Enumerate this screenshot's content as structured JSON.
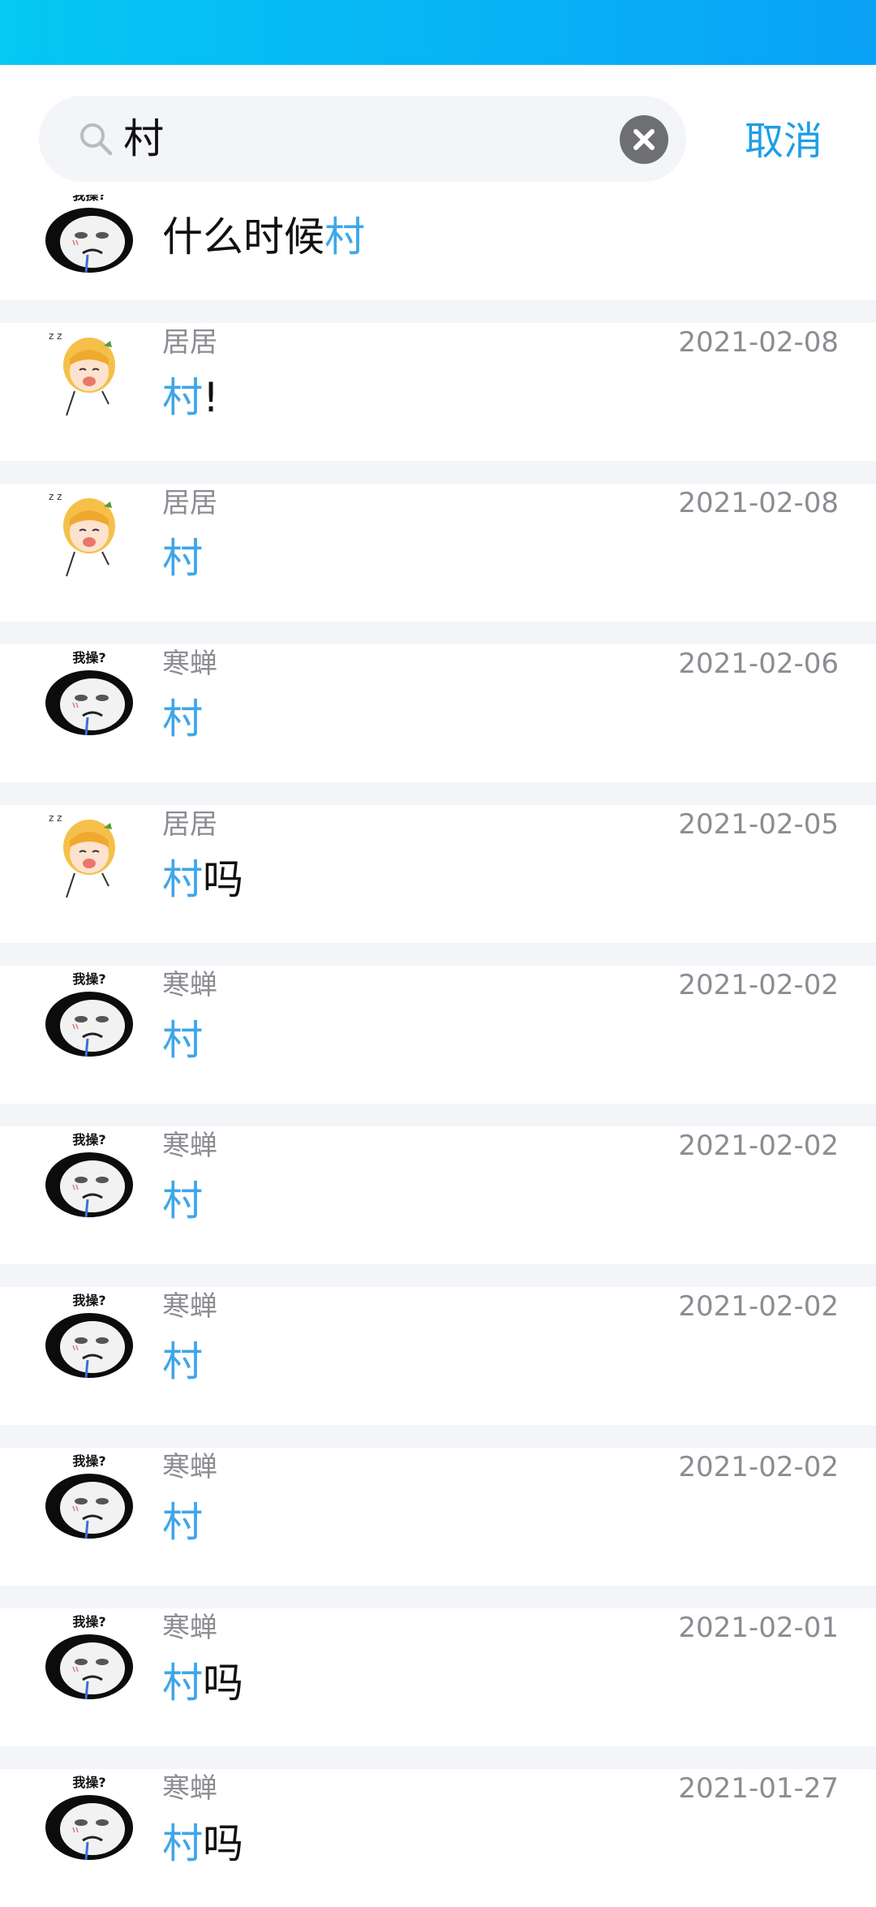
{
  "colors": {
    "accent": "#1f9ee5",
    "highlight": "#3fa6e8",
    "topbar_start": "#05c8f3",
    "topbar_end": "#0aa2f7"
  },
  "search": {
    "query": "村",
    "cancel_label": "取消"
  },
  "first_result": {
    "text_before": "什么时候",
    "highlight": "村",
    "avatar": "panda-meme"
  },
  "results": [
    {
      "sender": "居居",
      "date": "2021-02-08",
      "highlight": "村",
      "rest": "!",
      "avatar": "anime-girl"
    },
    {
      "sender": "居居",
      "date": "2021-02-08",
      "highlight": "村",
      "rest": "",
      "avatar": "anime-girl"
    },
    {
      "sender": "寒蝉",
      "date": "2021-02-06",
      "highlight": "村",
      "rest": "",
      "avatar": "panda-meme"
    },
    {
      "sender": "居居",
      "date": "2021-02-05",
      "highlight": "村",
      "rest": "吗",
      "avatar": "anime-girl"
    },
    {
      "sender": "寒蝉",
      "date": "2021-02-02",
      "highlight": "村",
      "rest": "",
      "avatar": "panda-meme"
    },
    {
      "sender": "寒蝉",
      "date": "2021-02-02",
      "highlight": "村",
      "rest": "",
      "avatar": "panda-meme"
    },
    {
      "sender": "寒蝉",
      "date": "2021-02-02",
      "highlight": "村",
      "rest": "",
      "avatar": "panda-meme"
    },
    {
      "sender": "寒蝉",
      "date": "2021-02-02",
      "highlight": "村",
      "rest": "",
      "avatar": "panda-meme"
    },
    {
      "sender": "寒蝉",
      "date": "2021-02-01",
      "highlight": "村",
      "rest": "吗",
      "avatar": "panda-meme"
    },
    {
      "sender": "寒蝉",
      "date": "2021-01-27",
      "highlight": "村",
      "rest": "吗",
      "avatar": "panda-meme"
    }
  ],
  "panda_caption": "我操?"
}
